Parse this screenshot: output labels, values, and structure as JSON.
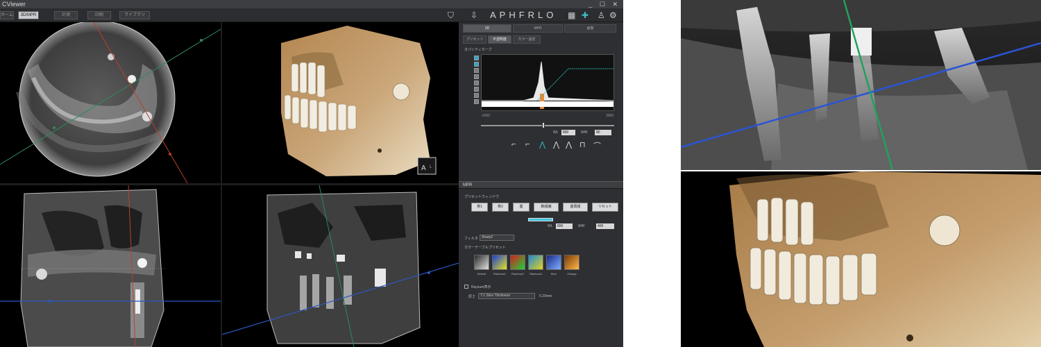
{
  "window": {
    "title": "CViewer",
    "controls": "_ ☐ ✕"
  },
  "toolbar": {
    "tabs": [
      "ホーム",
      "3D/MPR",
      "計測",
      "印刷",
      "ライブラリ"
    ],
    "active_tab": 1,
    "brand": "APHFRLO"
  },
  "viewports": {
    "vr_orientation_label": "A",
    "vr_orientation_label2": "L"
  },
  "side_panel": {
    "tabs_top": [
      "3D",
      "MPR",
      "画像"
    ],
    "tabs_sub": [
      "プリセット",
      "不透明度",
      "カラー設定"
    ],
    "active_sub_tab": 1,
    "curve_label": "オパシティカーブ",
    "curve_numbers": [
      "1",
      "2",
      "3"
    ],
    "range_min": "-1000",
    "range_max": "3000",
    "wl_label": "WL",
    "wl_value": "800",
    "ww_label": "WW",
    "ww_value": "80",
    "curve_shapes": [
      "⌐",
      "⌐",
      "⋀",
      "⋀",
      "⋀",
      "⊓",
      "⌒"
    ],
    "mpr_title": "MPR",
    "window_preset_label": "プリセットウィンドウ",
    "preset_buttons": [
      "骨1",
      "骨2",
      "歯",
      "軟組織",
      "歯周組",
      "リセット"
    ],
    "level_label": "WL",
    "level_value": "800",
    "width_label": "WW",
    "width_value": "400",
    "filter_label": "フィルタ",
    "filter_value": "Sharp2",
    "color_table_label": "カラーテーブルプリセット",
    "color_tables": [
      {
        "name": "Default",
        "color_a": "#2a2a2a",
        "color_b": "#e0e0e0"
      },
      {
        "name": "Rainbow1",
        "color_a": "#1c3fd6",
        "color_b": "#e6e01e"
      },
      {
        "name": "Rainbow2",
        "color_a": "#d21e1e",
        "color_b": "#1ed23c"
      },
      {
        "name": "Rainbow3",
        "color_a": "#1e8ad2",
        "color_b": "#e6d21e"
      },
      {
        "name": "Blue",
        "color_a": "#1a2a8a",
        "color_b": "#7fb0ff"
      },
      {
        "name": "Orange",
        "color_a": "#7a3a06",
        "color_b": "#ffb84a"
      }
    ],
    "raysum_label": "Raysum表示",
    "thickness_label": "厚さ",
    "thickness_value": "7.1 Slice Thickness",
    "thickness_mm": "5.20mm"
  }
}
